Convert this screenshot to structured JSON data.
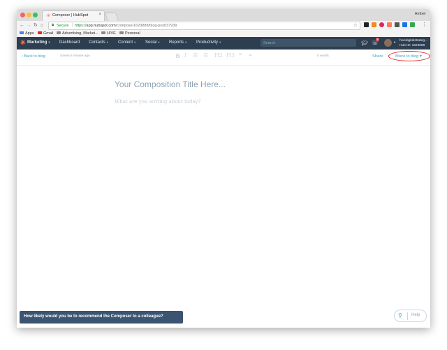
{
  "browser": {
    "tab_title": "Composer | HubSpot",
    "tab_close": "×",
    "profile_name": "Amber",
    "secure_label": "Secure",
    "url_scheme": "https://",
    "url_host": "app.hubspot.com",
    "url_path": "/compose/1629888/blog-post/37939",
    "bookmarks": [
      "Apps",
      "Gmail",
      "Advertising, Market...",
      "HIVE",
      "Personal"
    ]
  },
  "hubspot_nav": {
    "marketing": "Marketing",
    "items": [
      "Dashboard",
      "Contacts",
      "Content",
      "Social",
      "Reports",
      "Productivity"
    ],
    "search_placeholder": "Search",
    "hub_name": "hivedigitalstrateg...",
    "hub_id": "Hub ID: 1629888",
    "notification_count": "5"
  },
  "composer": {
    "back_label": "Back to blog",
    "saved_status": "Saved a minute ago",
    "word_count": "0 words",
    "share_label": "Share",
    "move_label": "Move to blog",
    "format_buttons": [
      "B",
      "I",
      "H2",
      "H3",
      "❝"
    ]
  },
  "editor": {
    "title_placeholder": "Your Composition Title Here...",
    "body_placeholder": "What are you writing about today?"
  },
  "footer": {
    "survey_text": "How likely would you be to recommend the Composer to a colleague?",
    "help_label": "Help"
  }
}
